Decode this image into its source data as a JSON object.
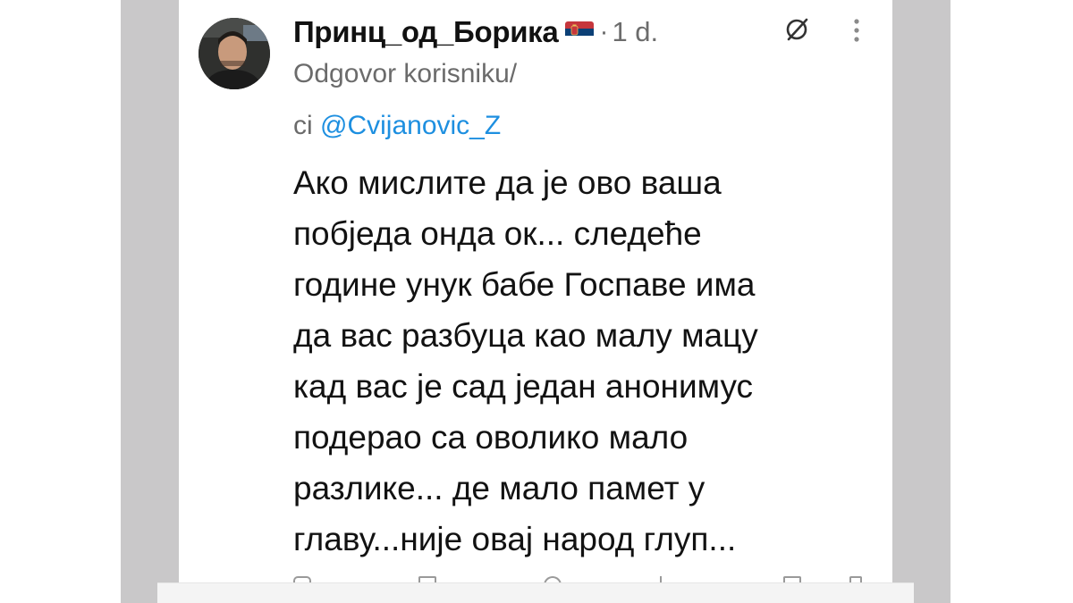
{
  "tweet": {
    "display_name": "Принц_од_Борика",
    "flag": "serbia-flag-icon",
    "separator": "·",
    "timestamp": "1 d.",
    "reply_prefix_line1": "Odgovor korisniku/",
    "reply_prefix_line2": "ci ",
    "reply_mention": "@Cvijanovic_Z",
    "body_lines": [
      "Ако мислите да је ово ваша",
      "побједа онда ок... следеће",
      "године унук бабе Госпаве има",
      "да вас разбуца као малу мацу",
      "кад вас је сад један анонимус",
      "подерао са оволико мало",
      "разлике... де мало памет у",
      "главу...није овај народ глуп..."
    ]
  },
  "icons": {
    "avatar": "user-avatar",
    "grok": "grok-icon",
    "more": "more-options-icon",
    "actions": [
      "reply-icon",
      "retweet-icon",
      "like-icon",
      "views-icon",
      "bookmark-icon",
      "share-icon"
    ]
  },
  "colors": {
    "side_panel": "#c9c8c9",
    "mention": "#1d8fe0",
    "muted_text": "#6b6b6b",
    "body_text": "#121212"
  }
}
